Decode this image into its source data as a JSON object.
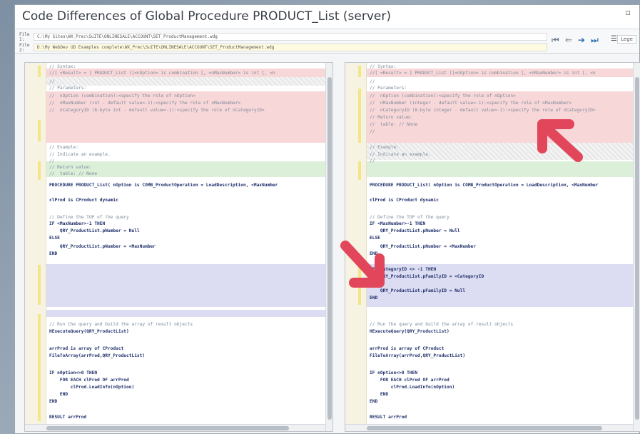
{
  "window": {
    "title": "Code Differences of Global Procedure PRODUCT_List (server)",
    "close_glyph": "▫"
  },
  "files": {
    "file1_label": "File 1:",
    "file1_path": "C:\\My Sites\\WX_Prec\\SuITE\\ONLINESALE\\ACCOUNT\\SET_ProductManagement.wdg",
    "file2_label": "File 2:",
    "file2_path": "D:\\My WebDev UD Examples complete\\WX_Prec\\SuITE\\ONLINESALE\\ACCOUNT\\SET_ProductManagement.wdg"
  },
  "toolbar": {
    "first_diff_icon": "first-difference-icon",
    "prev_diff_icon": "previous-difference-icon",
    "next_diff_icon": "next-difference-icon",
    "last_diff_icon": "last-difference-icon",
    "menu_icon": "menu-icon",
    "legend_label": "Lege"
  },
  "left_code": [
    {
      "text": "// Syntax:",
      "cls": "cm"
    },
    {
      "text": "//[ <Result> = ] PRODUCT_List ([<nOption> is combination [, <nMaxNumber> is int [, <n",
      "cls": "cm"
    },
    {
      "text": "//",
      "cls": "cm"
    },
    {
      "text": "// Parameters:",
      "cls": "cm"
    },
    {
      "text": "//  nOption (combination):<specify the role of nOption>",
      "cls": "cm"
    },
    {
      "text": "//  nMaxNumber (int - default value=-1):<specify the role of nMaxNumber>",
      "cls": "cm"
    },
    {
      "text": "//  nCategoryID (8-byte int - default value=-1):<specify the role of nCategoryID>",
      "cls": "cm"
    },
    {
      "text": "// Example:",
      "cls": "cm"
    },
    {
      "text": "// Indicate an example.",
      "cls": "cm"
    },
    {
      "text": "//",
      "cls": "cm"
    },
    {
      "text": "// Return value:",
      "cls": "cm"
    },
    {
      "text": "//  table: // None",
      "cls": "cm"
    },
    {
      "text": "PROCEDURE PRODUCT_List( nOption is COMB_ProductOperation = LoadDescription, <MaxNumber",
      "cls": "kw"
    },
    {
      "text": "clProd is CProduct dynamic",
      "cls": "kw"
    },
    {
      "text": "// Define the TOP of the query",
      "cls": "cm"
    },
    {
      "text": "IF <MaxNumber>-1 THEN",
      "cls": "kw"
    },
    {
      "text": "    QRY_ProductList.pNumber = Null",
      "cls": "kw"
    },
    {
      "text": "ELSE",
      "cls": "kw"
    },
    {
      "text": "    QRY_ProductList.pNumber = <MaxNumber",
      "cls": "kw"
    },
    {
      "text": "END",
      "cls": "kw"
    },
    {
      "text": "// Run the query and build the array of result objects",
      "cls": "cm"
    },
    {
      "text": "HExecuteQuery(QRY_ProductList)",
      "cls": "kw"
    },
    {
      "text": "arrProd is array of CProduct",
      "cls": "kw"
    },
    {
      "text": "FileToArray(arrProd,QRY_ProductList)",
      "cls": "kw"
    },
    {
      "text": "IF nOption<>0 THEN",
      "cls": "kw"
    },
    {
      "text": "    FOR EACH clProd OF arrProd",
      "cls": "kw"
    },
    {
      "text": "        clProd.LoadInfo(nOption)",
      "cls": "kw"
    },
    {
      "text": "    END",
      "cls": "kw"
    },
    {
      "text": "END",
      "cls": "kw"
    },
    {
      "text": "RESULT arrProd",
      "cls": "kw"
    }
  ],
  "right_code": [
    {
      "text": "// Syntax:",
      "cls": "cm"
    },
    {
      "text": "//[ <Result> = ] PRODUCT_List ([<nOption> is combination [, <nMaxNumber> is int [, <n",
      "cls": "cm"
    },
    {
      "text": "//",
      "cls": "cm"
    },
    {
      "text": "// Parameters:",
      "cls": "cm"
    },
    {
      "text": "//  nOption (combination):<specify the role of nOption>",
      "cls": "cm"
    },
    {
      "text": "//  nMaxNumber (integer - default value=-1):<specify the role of nMaxNumber>",
      "cls": "cm"
    },
    {
      "text": "//  nCategoryID (8-byte integer - default value=-1):<specify the role of nCategoryID>",
      "cls": "cm"
    },
    {
      "text": "// Return value:",
      "cls": "cm"
    },
    {
      "text": "//  table: // None",
      "cls": "cm"
    },
    {
      "text": "//",
      "cls": "cm"
    },
    {
      "text": "// Example:",
      "cls": "cm"
    },
    {
      "text": "// Indicate an example.",
      "cls": "cm"
    },
    {
      "text": "//",
      "cls": "cm"
    },
    {
      "text": "PROCEDURE PRODUCT_List( nOption is COMB_ProductOperation = LoadDescription, <MaxNumber",
      "cls": "kw"
    },
    {
      "text": "clProd is CProduct dynamic",
      "cls": "kw"
    },
    {
      "text": "// Define the TOP of the query",
      "cls": "cm"
    },
    {
      "text": "IF <MaxNumber>-1 THEN",
      "cls": "kw"
    },
    {
      "text": "    QRY_ProductList.pNumber = Null",
      "cls": "kw"
    },
    {
      "text": "ELSE",
      "cls": "kw"
    },
    {
      "text": "    QRY_ProductList.pNumber = <MaxNumber",
      "cls": "kw"
    },
    {
      "text": "END",
      "cls": "kw"
    },
    {
      "text": "IF <CategoryID <> -1 THEN",
      "cls": "kw"
    },
    {
      "text": "    QRY_ProductList.pFamilyID = <CategoryID",
      "cls": "kw"
    },
    {
      "text": "ELSE",
      "cls": "kw"
    },
    {
      "text": "    QRY_ProductList.pFamilyID = Null",
      "cls": "kw"
    },
    {
      "text": "END",
      "cls": "kw"
    },
    {
      "text": "// Run the query and build the array of result objects",
      "cls": "cm"
    },
    {
      "text": "HExecuteQuery(QRY_ProductList)",
      "cls": "kw"
    },
    {
      "text": "arrProd is array of CProduct",
      "cls": "kw"
    },
    {
      "text": "FileToArray(arrProd,QRY_ProductList)",
      "cls": "kw"
    },
    {
      "text": "IF nOption<>0 THEN",
      "cls": "kw"
    },
    {
      "text": "    FOR EACH clProd OF arrProd",
      "cls": "kw"
    },
    {
      "text": "        clProd.LoadInfo(nOption)",
      "cls": "kw"
    },
    {
      "text": "    END",
      "cls": "kw"
    },
    {
      "text": "END",
      "cls": "kw"
    },
    {
      "text": "RESULT arrProd",
      "cls": "kw"
    }
  ],
  "annotations": {
    "arrow_color": "#e2465a",
    "arrow_icon": "red-annotation-arrow-icon"
  }
}
